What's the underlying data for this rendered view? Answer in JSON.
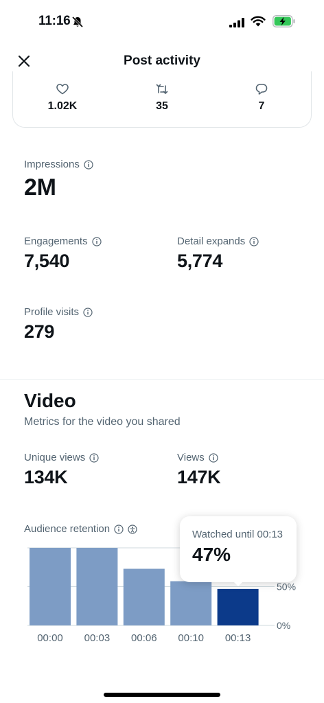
{
  "status_bar": {
    "time": "11:16",
    "icons": [
      "bell-slash-icon",
      "cellular-signal-icon",
      "wifi-icon",
      "battery-charging-icon"
    ],
    "battery_color": "#34c759"
  },
  "header": {
    "title": "Post activity",
    "close_icon": "close-icon"
  },
  "engagement": {
    "likes": "1.02K",
    "reposts": "35",
    "replies": "7"
  },
  "stats": {
    "impressions": {
      "label": "Impressions",
      "value": "2M"
    },
    "engagements": {
      "label": "Engagements",
      "value": "7,540"
    },
    "detail_expands": {
      "label": "Detail expands",
      "value": "5,774"
    },
    "profile_visits": {
      "label": "Profile visits",
      "value": "279"
    }
  },
  "video": {
    "title": "Video",
    "subtitle": "Metrics for the video you shared",
    "unique_views": {
      "label": "Unique views",
      "value": "134K"
    },
    "views": {
      "label": "Views",
      "value": "147K"
    },
    "retention_label": "Audience retention",
    "tooltip": {
      "label": "Watched until 00:13",
      "value": "47%"
    }
  },
  "colors": {
    "bar": "#7d9cc5",
    "bar_selected": "#0c3a8a",
    "text_secondary": "#536471"
  },
  "chart_data": {
    "type": "bar",
    "categories": [
      "00:00",
      "00:03",
      "00:06",
      "00:10",
      "00:13"
    ],
    "values": [
      100,
      100,
      73,
      57,
      47
    ],
    "selected_index": 4,
    "y_tick_labels": [
      "50%",
      "0%"
    ],
    "ylim": [
      0,
      100
    ],
    "grid": true
  }
}
